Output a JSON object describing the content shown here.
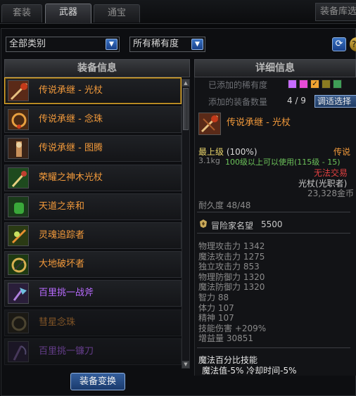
{
  "tabs": [
    {
      "label": "套装",
      "active": false
    },
    {
      "label": "武器",
      "active": true
    },
    {
      "label": "通宝",
      "active": false
    }
  ],
  "tab_right_label": "装备库选",
  "filters": {
    "category": "全部类别",
    "rarity": "所有稀有度"
  },
  "left_panel": {
    "header": "装备信息",
    "items": [
      {
        "name": "传说承继 - 光杖",
        "color": "#f39a3b",
        "selected": true,
        "dim": false,
        "icon": "staff-icon"
      },
      {
        "name": "传说承继 - 念珠",
        "color": "#f39a3b",
        "selected": false,
        "dim": false,
        "icon": "rosary-icon"
      },
      {
        "name": "传说承继 - 图腾",
        "color": "#f39a3b",
        "selected": false,
        "dim": false,
        "icon": "totem-icon"
      },
      {
        "name": "荣耀之神木光杖",
        "color": "#f39a3b",
        "selected": false,
        "dim": false,
        "icon": "wood-staff-icon"
      },
      {
        "name": "天道之亲和",
        "color": "#f39a3b",
        "selected": false,
        "dim": false,
        "icon": "glove-icon"
      },
      {
        "name": "灵魂追踪者",
        "color": "#f39a3b",
        "selected": false,
        "dim": false,
        "icon": "soul-icon"
      },
      {
        "name": "大地破坏者",
        "color": "#f39a3b",
        "selected": false,
        "dim": false,
        "icon": "earth-icon"
      },
      {
        "name": "百里挑一战斧",
        "color": "#b86bff",
        "selected": false,
        "dim": false,
        "icon": "axe-icon"
      },
      {
        "name": "彗星念珠",
        "color": "#f39a3b",
        "selected": false,
        "dim": true,
        "icon": "comet-icon"
      },
      {
        "name": "百里挑一镰刀",
        "color": "#b86bff",
        "selected": false,
        "dim": true,
        "icon": "scythe-icon"
      }
    ],
    "button": "装备变换"
  },
  "right_panel": {
    "header": "详细信息",
    "added_rarity_label": "已添加的稀有度",
    "rarity_colors": [
      "#c76cff",
      "#e74bd6",
      "#f0a331",
      "#8b7c21",
      "#3f9e57"
    ],
    "added_count_label": "添加的装备数量",
    "added_count": "4 / 9",
    "add_button": "调适选择",
    "item": {
      "name": "传说承继 - 光杖",
      "grade": "最上级",
      "grade_pct": "(100%)",
      "rarity": "传说",
      "weight": "3.1kg",
      "level_req": "100级以上可以使用(115级 - 15)",
      "trade": "无法交易",
      "type": "光杖(光职者)",
      "price": "23,328金币",
      "durability": "耐久度 48/48",
      "fame_label": "冒险家名望",
      "fame_value": "5500",
      "stats": [
        {
          "label": "物理攻击力",
          "value": "1342"
        },
        {
          "label": "魔法攻击力",
          "value": "1275"
        },
        {
          "label": "独立攻击力",
          "value": "853"
        },
        {
          "label": "物理防御力",
          "value": "1320"
        },
        {
          "label": "魔法防御力",
          "value": "1320"
        },
        {
          "label": "智力",
          "value": "88"
        },
        {
          "label": "体力",
          "value": "107"
        },
        {
          "label": "精神",
          "value": "107"
        },
        {
          "label": "技能伤害",
          "value": "+209%"
        },
        {
          "label": "增益量",
          "value": "30851"
        }
      ],
      "skill_title": "魔法百分比技能",
      "skill_desc": "魔法值-5% 冷却时间-5%"
    }
  }
}
